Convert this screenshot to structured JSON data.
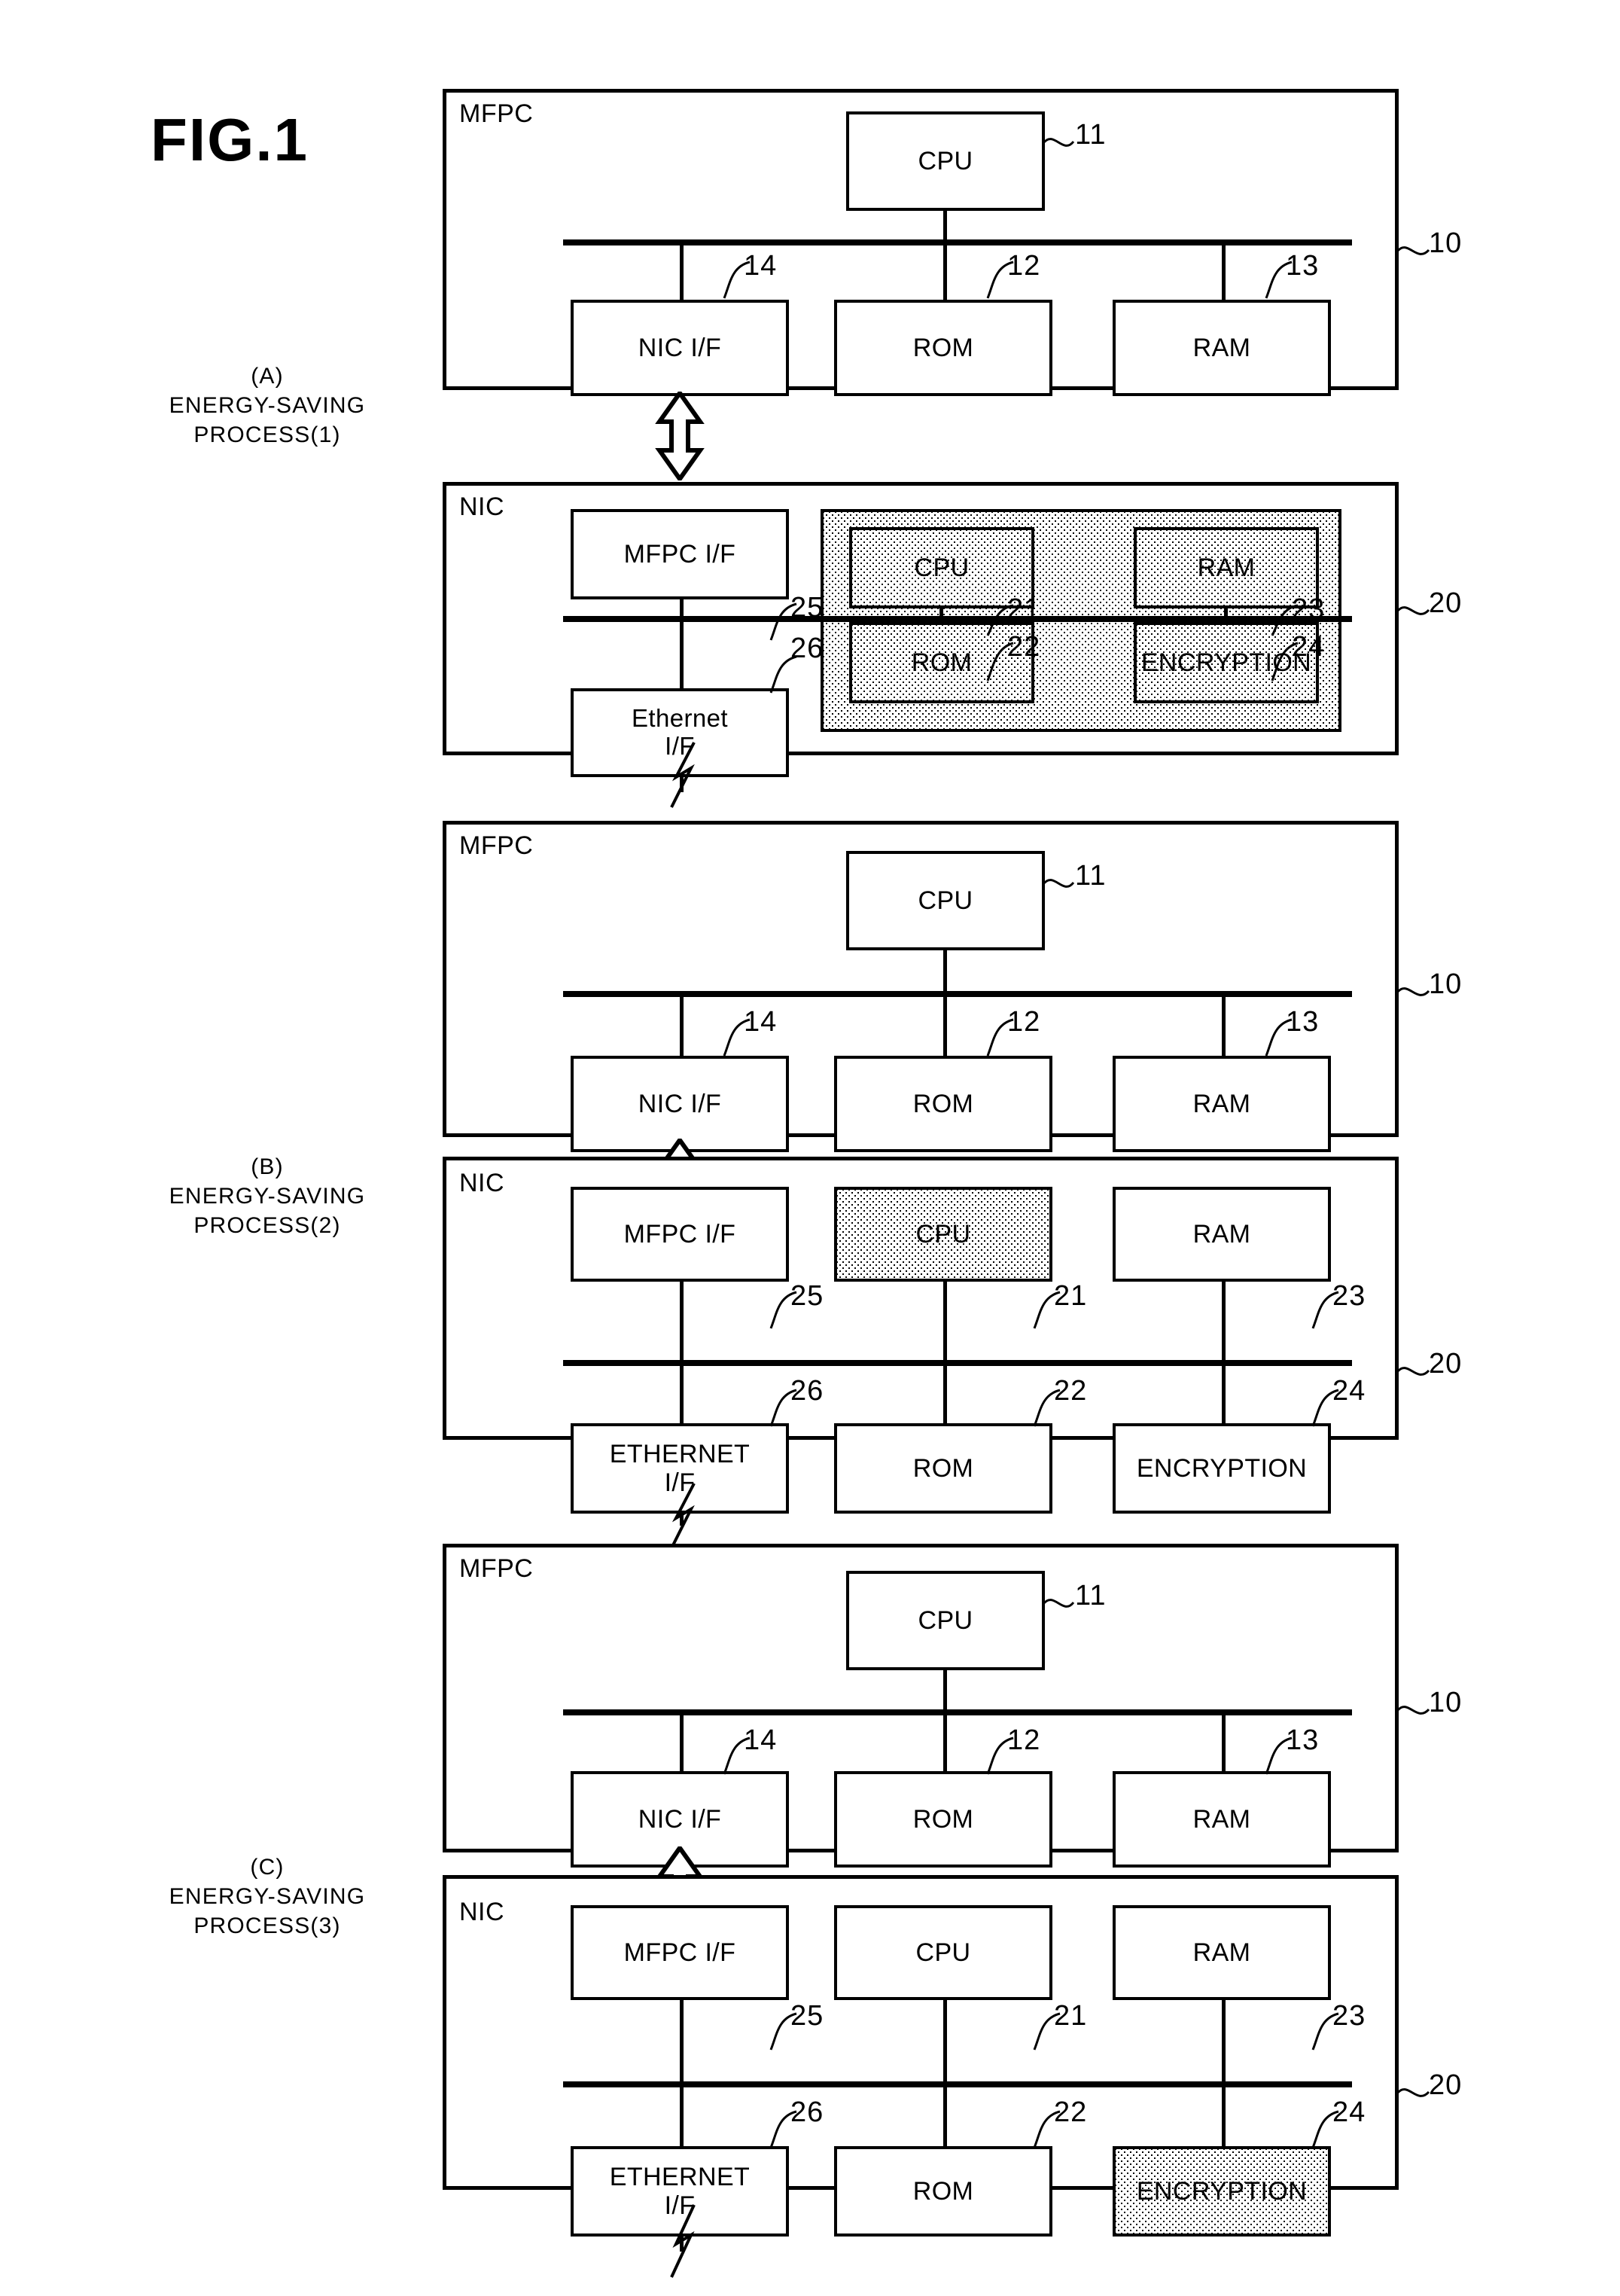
{
  "figure": {
    "title": "FIG.1"
  },
  "panels": [
    {
      "id": "A",
      "caption_letter": "(A)",
      "caption_line1": "ENERGY-SAVING",
      "caption_line2": "PROCESS(1)",
      "mfpc": {
        "label": "MFPC",
        "ref": "10",
        "blocks": [
          {
            "name": "cpu",
            "label": "CPU",
            "ref": "11",
            "shaded": false
          },
          {
            "name": "nic-if",
            "label": "NIC I/F",
            "ref": "14",
            "shaded": false
          },
          {
            "name": "rom",
            "label": "ROM",
            "ref": "12",
            "shaded": false
          },
          {
            "name": "ram",
            "label": "RAM",
            "ref": "13",
            "shaded": false
          }
        ]
      },
      "nic": {
        "label": "NIC",
        "ref": "20",
        "shaded_group": true,
        "blocks": [
          {
            "name": "mfpc-if",
            "label": "MFPC I/F",
            "ref": "25",
            "shaded": false
          },
          {
            "name": "ethernet-if",
            "label": "Ethernet\nI/F",
            "ref": "26",
            "shaded": false
          },
          {
            "name": "cpu",
            "label": "CPU",
            "ref": "21",
            "shaded": true
          },
          {
            "name": "ram",
            "label": "RAM",
            "ref": "23",
            "shaded": true
          },
          {
            "name": "rom",
            "label": "ROM",
            "ref": "22",
            "shaded": true
          },
          {
            "name": "encryption",
            "label": "ENCRYPTION",
            "ref": "24",
            "shaded": true
          }
        ]
      }
    },
    {
      "id": "B",
      "caption_letter": "(B)",
      "caption_line1": "ENERGY-SAVING",
      "caption_line2": "PROCESS(2)",
      "mfpc": {
        "label": "MFPC",
        "ref": "10",
        "blocks": [
          {
            "name": "cpu",
            "label": "CPU",
            "ref": "11",
            "shaded": false
          },
          {
            "name": "nic-if",
            "label": "NIC I/F",
            "ref": "14",
            "shaded": false
          },
          {
            "name": "rom",
            "label": "ROM",
            "ref": "12",
            "shaded": false
          },
          {
            "name": "ram",
            "label": "RAM",
            "ref": "13",
            "shaded": false
          }
        ]
      },
      "nic": {
        "label": "NIC",
        "ref": "20",
        "shaded_group": false,
        "blocks": [
          {
            "name": "mfpc-if",
            "label": "MFPC I/F",
            "ref": "25",
            "shaded": false
          },
          {
            "name": "ethernet-if",
            "label": "ETHERNET\nI/F",
            "ref": "26",
            "shaded": false
          },
          {
            "name": "cpu",
            "label": "CPU",
            "ref": "21",
            "shaded": true
          },
          {
            "name": "ram",
            "label": "RAM",
            "ref": "23",
            "shaded": false
          },
          {
            "name": "rom",
            "label": "ROM",
            "ref": "22",
            "shaded": false
          },
          {
            "name": "encryption",
            "label": "ENCRYPTION",
            "ref": "24",
            "shaded": false
          }
        ]
      }
    },
    {
      "id": "C",
      "caption_letter": "(C)",
      "caption_line1": "ENERGY-SAVING",
      "caption_line2": "PROCESS(3)",
      "mfpc": {
        "label": "MFPC",
        "ref": "10",
        "blocks": [
          {
            "name": "cpu",
            "label": "CPU",
            "ref": "11",
            "shaded": false
          },
          {
            "name": "nic-if",
            "label": "NIC I/F",
            "ref": "14",
            "shaded": false
          },
          {
            "name": "rom",
            "label": "ROM",
            "ref": "12",
            "shaded": false
          },
          {
            "name": "ram",
            "label": "RAM",
            "ref": "13",
            "shaded": false
          }
        ]
      },
      "nic": {
        "label": "NIC",
        "ref": "20",
        "shaded_group": false,
        "blocks": [
          {
            "name": "mfpc-if",
            "label": "MFPC I/F",
            "ref": "25",
            "shaded": false
          },
          {
            "name": "ethernet-if",
            "label": "ETHERNET\nI/F",
            "ref": "26",
            "shaded": false
          },
          {
            "name": "cpu",
            "label": "CPU",
            "ref": "21",
            "shaded": false
          },
          {
            "name": "ram",
            "label": "RAM",
            "ref": "23",
            "shaded": false
          },
          {
            "name": "rom",
            "label": "ROM",
            "ref": "22",
            "shaded": false
          },
          {
            "name": "encryption",
            "label": "ENCRYPTION",
            "ref": "24",
            "shaded": true
          }
        ]
      }
    }
  ],
  "icons": {
    "mfpc_nic_link": "double-headed-vertical-arrow",
    "ethernet_break": "line-break-zigzag",
    "ref_leader": "squiggle-leader-line"
  }
}
